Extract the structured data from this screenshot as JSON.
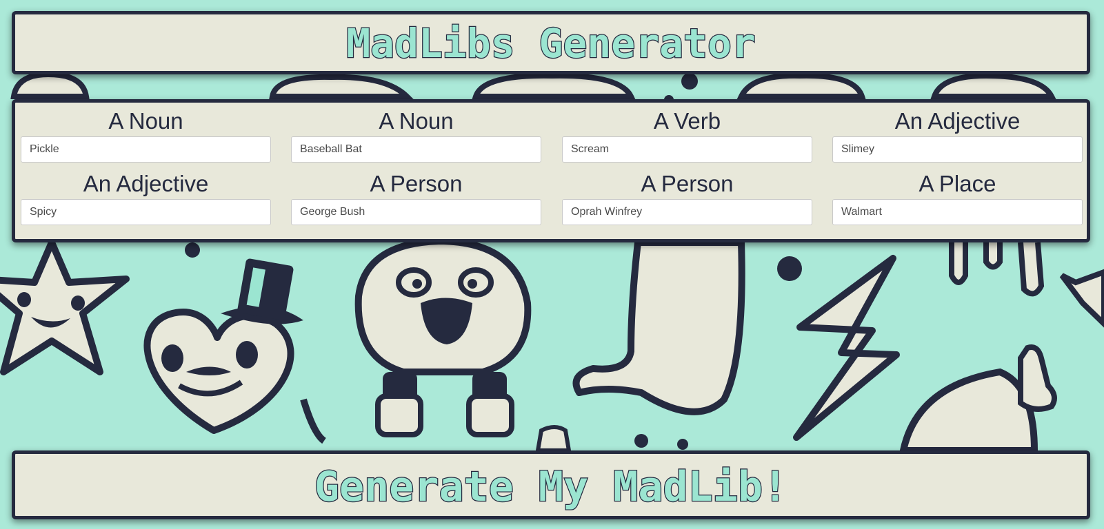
{
  "header": {
    "title": "MadLibs Generator"
  },
  "fields": [
    {
      "label": "A Noun",
      "value": "Pickle"
    },
    {
      "label": "A Noun",
      "value": "Baseball Bat"
    },
    {
      "label": "A Verb",
      "value": "Scream"
    },
    {
      "label": "An Adjective",
      "value": "Slimey"
    },
    {
      "label": "An Adjective",
      "value": "Spicy"
    },
    {
      "label": "A Person",
      "value": "George Bush"
    },
    {
      "label": "A Person",
      "value": "Oprah Winfrey"
    },
    {
      "label": "A Place",
      "value": "Walmart"
    }
  ],
  "footer": {
    "button_label": "Generate My MadLib!"
  },
  "colors": {
    "background": "#abe9d8",
    "panel": "#e8e8da",
    "ink": "#252a3f",
    "accent": "#9be5d1"
  }
}
